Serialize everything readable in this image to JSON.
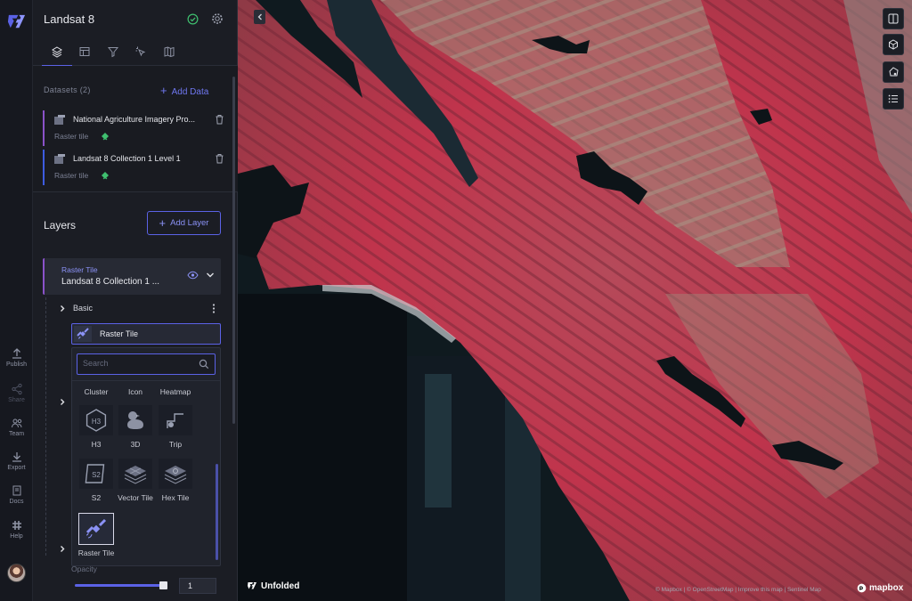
{
  "app": {
    "title": "Landsat 8"
  },
  "rail": {
    "items": [
      {
        "label": "Publish"
      },
      {
        "label": "Share"
      },
      {
        "label": "Team"
      },
      {
        "label": "Export"
      },
      {
        "label": "Docs"
      },
      {
        "label": "Help"
      }
    ]
  },
  "datasets": {
    "label": "Datasets (2)",
    "add_label": "Add Data",
    "items": [
      {
        "name": "National Agriculture Imagery Pro...",
        "type": "Raster tile",
        "color": "#8a52c9"
      },
      {
        "name": "Landsat 8 Collection 1 Level 1",
        "type": "Raster tile",
        "color": "#3d5ce0"
      }
    ]
  },
  "layers": {
    "title": "Layers",
    "add_label": "Add Layer",
    "card": {
      "kind": "Raster Tile",
      "name": "Landsat 8 Collection 1 ..."
    },
    "basic_label": "Basic",
    "selected_type": "Raster Tile",
    "search_placeholder": "Search",
    "options": [
      {
        "label": "Cluster"
      },
      {
        "label": "Icon"
      },
      {
        "label": "Heatmap"
      },
      {
        "label": "H3"
      },
      {
        "label": "3D"
      },
      {
        "label": "Trip"
      },
      {
        "label": "S2"
      },
      {
        "label": "Vector Tile"
      },
      {
        "label": "Hex Tile"
      },
      {
        "label": "Raster Tile"
      }
    ],
    "opacity_label": "Opacity",
    "opacity_value": "1",
    "opacity_fraction": 1
  },
  "map": {
    "brand": "Unfolded",
    "attribution": "© Mapbox | © OpenStreetMap | Improve this map | Sentinel Map",
    "mapbox": "mapbox"
  },
  "colors": {
    "accent": "#5b62e6",
    "vegetation": "#c8384f"
  }
}
